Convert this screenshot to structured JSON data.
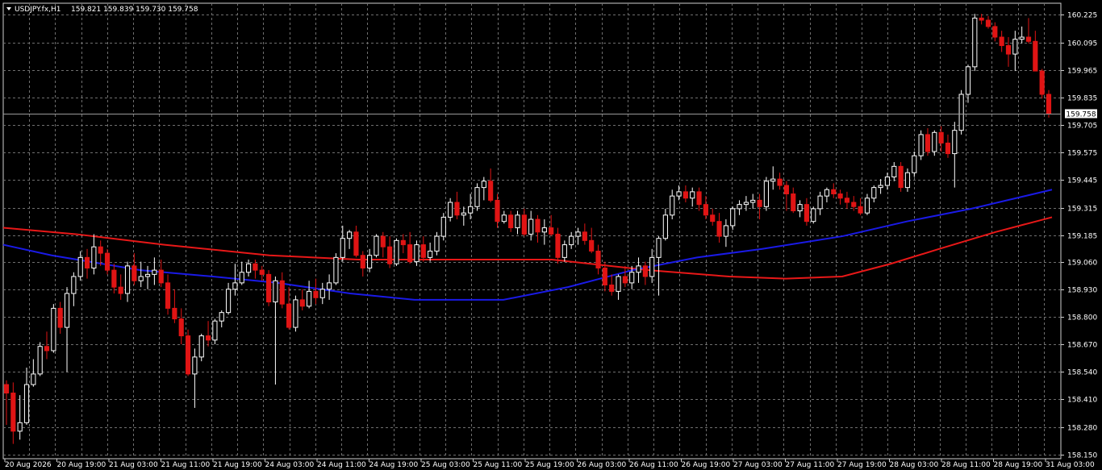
{
  "header": {
    "symbol": "USDJPY.fx,H1",
    "ohlc": "159.821 159.839 159.730 159.758"
  },
  "colors": {
    "background": "#000000",
    "grid": "#6f6f6f",
    "bull_candle": "#ffffff",
    "bear_candle": "#e01414",
    "ma_fast": "#1a1ae6",
    "ma_slow": "#e81818",
    "price_line": "#9a9a9a"
  },
  "current_price_label": "159.758",
  "chart_data": {
    "type": "candlestick",
    "ylim": [
      58.13,
      160.28
    ],
    "y_range": [
      158.13,
      160.28
    ],
    "y_ticks": [
      "160.225",
      "160.095",
      "159.965",
      "159.835",
      "159.705",
      "159.575",
      "159.445",
      "159.315",
      "159.185",
      "159.060",
      "158.930",
      "158.800",
      "158.670",
      "158.540",
      "158.410",
      "158.280",
      "158.150"
    ],
    "x_ticks": [
      "20 Aug 2026",
      "20 Aug 19:00",
      "21 Aug 03:00",
      "21 Aug 11:00",
      "21 Aug 19:00",
      "24 Aug 03:00",
      "24 Aug 11:00",
      "24 Aug 19:00",
      "25 Aug 03:00",
      "25 Aug 11:00",
      "25 Aug 19:00",
      "26 Aug 03:00",
      "26 Aug 11:00",
      "26 Aug 19:00",
      "27 Aug 03:00",
      "27 Aug 11:00",
      "27 Aug 19:00",
      "28 Aug 03:00",
      "28 Aug 11:00",
      "28 Aug 19:00",
      "31 Aug 03:00"
    ],
    "current_price": 159.758,
    "candles": [
      [
        158.48,
        158.5,
        158.29,
        158.44
      ],
      [
        158.44,
        158.49,
        158.2,
        158.26
      ],
      [
        158.26,
        158.43,
        158.22,
        158.3
      ],
      [
        158.3,
        158.56,
        158.29,
        158.48
      ],
      [
        158.48,
        158.6,
        158.47,
        158.53
      ],
      [
        158.53,
        158.68,
        158.52,
        158.66
      ],
      [
        158.66,
        158.73,
        158.6,
        158.64
      ],
      [
        158.64,
        158.86,
        158.63,
        158.84
      ],
      [
        158.84,
        158.87,
        158.72,
        158.75
      ],
      [
        158.75,
        158.94,
        158.54,
        158.91
      ],
      [
        158.91,
        159.01,
        158.85,
        158.99
      ],
      [
        158.99,
        159.11,
        158.97,
        159.08
      ],
      [
        159.08,
        159.12,
        158.98,
        159.03
      ],
      [
        159.03,
        159.19,
        159.0,
        159.13
      ],
      [
        159.13,
        159.16,
        159.04,
        159.1
      ],
      [
        159.1,
        159.12,
        159.0,
        159.02
      ],
      [
        159.02,
        159.05,
        158.91,
        158.94
      ],
      [
        158.94,
        159.0,
        158.88,
        158.91
      ],
      [
        158.91,
        159.06,
        158.87,
        159.04
      ],
      [
        159.04,
        159.1,
        158.95,
        158.97
      ],
      [
        158.97,
        159.06,
        158.94,
        158.99
      ],
      [
        158.99,
        159.04,
        158.93,
        159.0
      ],
      [
        159.0,
        159.08,
        158.95,
        159.02
      ],
      [
        159.02,
        159.07,
        158.94,
        158.96
      ],
      [
        158.96,
        159.0,
        158.81,
        158.84
      ],
      [
        158.84,
        158.93,
        158.77,
        158.79
      ],
      [
        158.79,
        158.84,
        158.67,
        158.71
      ],
      [
        158.71,
        158.74,
        158.52,
        158.53
      ],
      [
        158.53,
        158.65,
        158.37,
        158.61
      ],
      [
        158.61,
        158.72,
        158.59,
        158.71
      ],
      [
        158.71,
        158.78,
        158.66,
        158.69
      ],
      [
        158.69,
        158.79,
        158.67,
        158.78
      ],
      [
        158.78,
        158.83,
        158.75,
        158.82
      ],
      [
        158.82,
        158.96,
        158.81,
        158.93
      ],
      [
        158.93,
        159.05,
        158.9,
        158.96
      ],
      [
        158.96,
        159.06,
        158.95,
        159.01
      ],
      [
        159.01,
        159.07,
        158.99,
        159.05
      ],
      [
        159.05,
        159.07,
        158.98,
        159.02
      ],
      [
        159.02,
        159.04,
        158.97,
        159.0
      ],
      [
        159.0,
        159.02,
        158.85,
        158.87
      ],
      [
        158.87,
        158.99,
        158.48,
        158.97
      ],
      [
        158.97,
        159.01,
        158.84,
        158.86
      ],
      [
        158.86,
        158.94,
        158.74,
        158.75
      ],
      [
        158.75,
        158.9,
        158.73,
        158.88
      ],
      [
        158.88,
        158.93,
        158.83,
        158.85
      ],
      [
        158.85,
        158.97,
        158.84,
        158.92
      ],
      [
        158.92,
        158.98,
        158.86,
        158.89
      ],
      [
        158.89,
        158.96,
        158.86,
        158.93
      ],
      [
        158.93,
        159.0,
        158.88,
        158.96
      ],
      [
        158.96,
        159.1,
        158.95,
        159.08
      ],
      [
        159.08,
        159.23,
        159.06,
        159.17
      ],
      [
        159.17,
        159.21,
        159.12,
        159.2
      ],
      [
        159.2,
        159.23,
        159.08,
        159.09
      ],
      [
        159.09,
        159.11,
        158.99,
        159.03
      ],
      [
        159.03,
        159.12,
        159.01,
        159.09
      ],
      [
        159.09,
        159.19,
        159.08,
        159.18
      ],
      [
        159.18,
        159.2,
        159.08,
        159.13
      ],
      [
        159.13,
        159.18,
        159.03,
        159.05
      ],
      [
        159.05,
        159.17,
        159.04,
        159.16
      ],
      [
        159.16,
        159.19,
        159.1,
        159.14
      ],
      [
        159.14,
        159.2,
        159.05,
        159.06
      ],
      [
        159.06,
        159.16,
        159.04,
        159.14
      ],
      [
        159.14,
        159.18,
        159.06,
        159.08
      ],
      [
        159.08,
        159.15,
        159.06,
        159.11
      ],
      [
        159.11,
        159.2,
        159.09,
        159.18
      ],
      [
        159.18,
        159.29,
        159.16,
        159.27
      ],
      [
        159.27,
        159.36,
        159.25,
        159.34
      ],
      [
        159.34,
        159.39,
        159.26,
        159.28
      ],
      [
        159.28,
        159.32,
        159.23,
        159.29
      ],
      [
        159.29,
        159.38,
        159.26,
        159.32
      ],
      [
        159.32,
        159.43,
        159.3,
        159.41
      ],
      [
        159.41,
        159.46,
        159.35,
        159.44
      ],
      [
        159.44,
        159.5,
        159.34,
        159.35
      ],
      [
        159.35,
        159.38,
        159.22,
        159.25
      ],
      [
        159.25,
        159.3,
        159.24,
        159.28
      ],
      [
        159.28,
        159.3,
        159.2,
        159.22
      ],
      [
        159.22,
        159.3,
        159.19,
        159.28
      ],
      [
        159.28,
        159.31,
        159.18,
        159.19
      ],
      [
        159.19,
        159.3,
        159.16,
        159.26
      ],
      [
        159.26,
        159.28,
        159.15,
        159.2
      ],
      [
        159.2,
        159.26,
        159.14,
        159.22
      ],
      [
        159.22,
        159.28,
        159.18,
        159.19
      ],
      [
        159.19,
        159.22,
        159.05,
        159.08
      ],
      [
        159.08,
        159.16,
        159.06,
        159.14
      ],
      [
        159.14,
        159.2,
        159.12,
        159.18
      ],
      [
        159.18,
        159.22,
        159.14,
        159.2
      ],
      [
        159.2,
        159.24,
        159.14,
        159.16
      ],
      [
        159.16,
        159.22,
        159.1,
        159.11
      ],
      [
        159.11,
        159.14,
        159.0,
        159.03
      ],
      [
        159.03,
        159.06,
        158.92,
        158.95
      ],
      [
        158.95,
        159.0,
        158.9,
        158.92
      ],
      [
        158.92,
        159.0,
        158.88,
        158.99
      ],
      [
        158.99,
        159.04,
        158.94,
        158.96
      ],
      [
        158.96,
        159.04,
        158.93,
        159.01
      ],
      [
        159.01,
        159.08,
        158.96,
        159.04
      ],
      [
        159.04,
        159.06,
        158.95,
        158.99
      ],
      [
        158.99,
        159.12,
        158.96,
        159.08
      ],
      [
        159.08,
        159.18,
        158.9,
        159.17
      ],
      [
        159.17,
        159.31,
        159.16,
        159.28
      ],
      [
        159.28,
        159.4,
        159.26,
        159.37
      ],
      [
        159.37,
        159.42,
        159.35,
        159.39
      ],
      [
        159.39,
        159.42,
        159.34,
        159.36
      ],
      [
        159.36,
        159.41,
        159.32,
        159.39
      ],
      [
        159.39,
        159.41,
        159.3,
        159.33
      ],
      [
        159.33,
        159.37,
        159.26,
        159.28
      ],
      [
        159.28,
        159.31,
        159.23,
        159.25
      ],
      [
        159.25,
        159.29,
        159.15,
        159.18
      ],
      [
        159.18,
        159.26,
        159.13,
        159.23
      ],
      [
        159.23,
        159.32,
        159.21,
        159.31
      ],
      [
        159.31,
        159.35,
        159.28,
        159.33
      ],
      [
        159.33,
        159.37,
        159.3,
        159.34
      ],
      [
        159.34,
        159.38,
        159.31,
        159.35
      ],
      [
        159.35,
        159.38,
        159.26,
        159.32
      ],
      [
        159.32,
        159.46,
        159.3,
        159.44
      ],
      [
        159.44,
        159.51,
        159.4,
        159.45
      ],
      [
        159.45,
        159.48,
        159.4,
        159.42
      ],
      [
        159.42,
        159.44,
        159.3,
        159.38
      ],
      [
        159.38,
        159.41,
        159.29,
        159.3
      ],
      [
        159.3,
        159.35,
        159.27,
        159.33
      ],
      [
        159.33,
        159.36,
        159.23,
        159.25
      ],
      [
        159.25,
        159.32,
        159.24,
        159.31
      ],
      [
        159.31,
        159.39,
        159.28,
        159.37
      ],
      [
        159.37,
        159.41,
        159.34,
        159.4
      ],
      [
        159.4,
        159.43,
        159.36,
        159.38
      ],
      [
        159.38,
        159.4,
        159.33,
        159.36
      ],
      [
        159.36,
        159.39,
        159.31,
        159.34
      ],
      [
        159.34,
        159.37,
        159.3,
        159.32
      ],
      [
        159.32,
        159.36,
        159.28,
        159.29
      ],
      [
        159.29,
        159.38,
        159.28,
        159.36
      ],
      [
        159.36,
        159.42,
        159.34,
        159.41
      ],
      [
        159.41,
        159.45,
        159.38,
        159.42
      ],
      [
        159.42,
        159.48,
        159.4,
        159.46
      ],
      [
        159.46,
        159.53,
        159.44,
        159.51
      ],
      [
        159.51,
        159.53,
        159.39,
        159.41
      ],
      [
        159.41,
        159.5,
        159.39,
        159.48
      ],
      [
        159.48,
        159.58,
        159.46,
        159.56
      ],
      [
        159.56,
        159.68,
        159.54,
        159.66
      ],
      [
        159.66,
        159.69,
        159.56,
        159.58
      ],
      [
        159.58,
        159.68,
        159.56,
        159.67
      ],
      [
        159.67,
        159.7,
        159.58,
        159.62
      ],
      [
        159.62,
        159.66,
        159.55,
        159.57
      ],
      [
        159.57,
        159.72,
        159.41,
        159.68
      ],
      [
        159.68,
        159.87,
        159.66,
        159.85
      ],
      [
        159.85,
        159.99,
        159.81,
        159.98
      ],
      [
        159.98,
        160.23,
        159.96,
        160.21
      ],
      [
        160.21,
        160.23,
        160.18,
        160.2
      ],
      [
        160.2,
        160.22,
        160.16,
        160.17
      ],
      [
        160.17,
        160.19,
        160.1,
        160.12
      ],
      [
        160.12,
        160.15,
        160.05,
        160.08
      ],
      [
        160.08,
        160.12,
        159.98,
        160.04
      ],
      [
        160.04,
        160.15,
        159.96,
        160.11
      ],
      [
        160.11,
        160.17,
        160.09,
        160.12
      ],
      [
        160.12,
        160.21,
        160.09,
        160.1
      ],
      [
        160.1,
        160.15,
        159.98,
        159.96
      ],
      [
        159.96,
        159.97,
        159.83,
        159.85
      ],
      [
        159.85,
        159.87,
        159.74,
        159.76
      ]
    ],
    "ma_fast": [
      [
        0,
        159.14
      ],
      [
        60,
        159.09
      ],
      [
        170,
        159.02
      ],
      [
        260,
        158.99
      ],
      [
        340,
        158.96
      ],
      [
        430,
        158.91
      ],
      [
        510,
        158.88
      ],
      [
        620,
        158.88
      ],
      [
        700,
        158.94
      ],
      [
        780,
        159.02
      ],
      [
        860,
        159.08
      ],
      [
        940,
        159.12
      ],
      [
        1040,
        159.18
      ],
      [
        1120,
        159.25
      ],
      [
        1200,
        159.31
      ],
      [
        1300,
        159.4
      ]
    ],
    "ma_slow": [
      [
        0,
        159.22
      ],
      [
        90,
        159.19
      ],
      [
        200,
        159.14
      ],
      [
        330,
        159.09
      ],
      [
        440,
        159.07
      ],
      [
        560,
        159.07
      ],
      [
        680,
        159.07
      ],
      [
        800,
        159.02
      ],
      [
        900,
        158.99
      ],
      [
        970,
        158.98
      ],
      [
        1040,
        158.99
      ],
      [
        1100,
        159.05
      ],
      [
        1160,
        159.12
      ],
      [
        1230,
        159.2
      ],
      [
        1300,
        159.27
      ]
    ]
  }
}
